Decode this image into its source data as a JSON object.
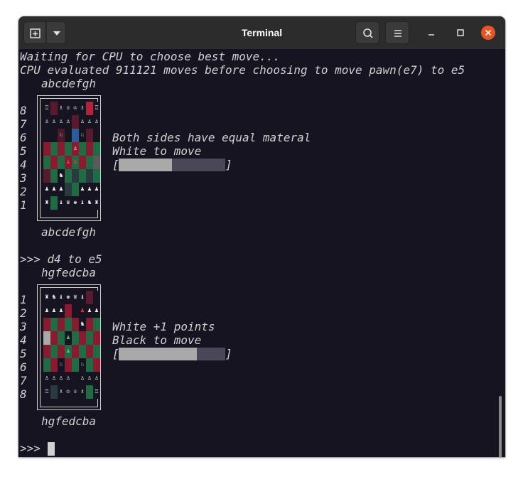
{
  "window": {
    "title": "Terminal",
    "icons": [
      "new-tab-icon",
      "chevron-down-icon",
      "search-icon",
      "hamburger-menu-icon",
      "minimize-icon",
      "maximize-icon",
      "close-icon"
    ],
    "colors": {
      "titlebar": "#2c2c2c",
      "terminal_bg": "#171421",
      "close": "#e95420",
      "text": "#d0d0d0"
    }
  },
  "terminal": {
    "line1": "Waiting for CPU to choose best move...",
    "line2": "CPU evaluated 911121 moves before choosing to move pawn(e7) to e5",
    "board1": {
      "files_top": "abcdefgh",
      "files_bottom": "abcdefgh",
      "ranks": [
        "8",
        "7",
        "6",
        "5",
        "4",
        "3",
        "2",
        "1"
      ],
      "info_line1": "Both sides have equal materal",
      "info_line2": "White to move",
      "bar_open": "[",
      "bar_close": "]",
      "bar_fraction": 0.5,
      "rows": [
        [
          "♖",
          "",
          "♗",
          "♕",
          "♔",
          "♗",
          "",
          "♖"
        ],
        [
          "♙",
          "♙",
          "♙",
          "♙",
          "",
          "♙",
          "♙",
          "♙"
        ],
        [
          "",
          "",
          "♘",
          "",
          "",
          "♘",
          "",
          ""
        ],
        [
          "",
          "",
          "",
          "",
          "♙",
          "",
          "",
          ""
        ],
        [
          "",
          "",
          "",
          "♟",
          "♟",
          "",
          "",
          ""
        ],
        [
          "",
          "",
          "♞",
          "",
          "",
          "",
          "",
          ""
        ],
        [
          "♟",
          "♟",
          "♟",
          "",
          "",
          "♟",
          "♟",
          "♟"
        ],
        [
          "♜",
          "",
          "♝",
          "♛",
          "♚",
          "♝",
          "♞",
          "♜"
        ]
      ],
      "colors": [
        [
          "#171421",
          "#5a1a2e",
          "#171421",
          "#171421",
          "#171421",
          "#171421",
          "#b8203a",
          "#171421"
        ],
        [
          "#171421",
          "#171421",
          "#171421",
          "#171421",
          "#5a1a2e",
          "#171421",
          "#171421",
          "#171421"
        ],
        [
          "#171421",
          "#171421",
          "#4a1a2a",
          "#171421",
          "#2a5aa0",
          "#171421",
          "#5a1a2e",
          "#171421"
        ],
        [
          "#8a1a30",
          "#1e6b44",
          "#8a1a30",
          "#1e6b44",
          "#8a1a30",
          "#1e6b44",
          "#8a1a30",
          "#1e6b44"
        ],
        [
          "#1e6b44",
          "#8a1a30",
          "#1e6b44",
          "#8a1a30",
          "#1e6b44",
          "#8a1a30",
          "#1e6b44",
          "#5a5a5a"
        ],
        [
          "#5a1a2e",
          "#1e6b44",
          "#171421",
          "#1e6b44",
          "#2a3a40",
          "#1e6b44",
          "#2a3a40",
          "#1e6b44"
        ],
        [
          "#171421",
          "#171421",
          "#171421",
          "#2a3a40",
          "#1e6b44",
          "#171421",
          "#171421",
          "#171421"
        ],
        [
          "#171421",
          "#1e6b44",
          "#171421",
          "#171421",
          "#171421",
          "#171421",
          "#171421",
          "#171421"
        ]
      ]
    },
    "command": ">>> d4 to e5",
    "board2": {
      "files_top": "hgfedcba",
      "files_bottom": "hgfedcba",
      "ranks": [
        "1",
        "2",
        "3",
        "4",
        "5",
        "6",
        "7",
        "8"
      ],
      "info_line1": "White +1 points",
      "info_line2": "Black to move",
      "bar_open": "[",
      "bar_close": "]",
      "bar_fraction": 0.73,
      "rows": [
        [
          "♜",
          "♞",
          "♝",
          "♚",
          "♛",
          "♝",
          "",
          ""
        ],
        [
          "♟",
          "♟",
          "♟",
          "",
          "",
          "♟",
          "♟",
          "♟"
        ],
        [
          "",
          "",
          "",
          "",
          "",
          "♞",
          "",
          ""
        ],
        [
          "",
          "",
          "",
          "♟",
          "",
          "",
          "",
          ""
        ],
        [
          "",
          "",
          "",
          "♟",
          "",
          "",
          "",
          ""
        ],
        [
          "",
          "",
          "♘",
          "",
          "",
          "♘",
          "",
          ""
        ],
        [
          "♙",
          "♙",
          "♙",
          "♙",
          "",
          "♙",
          "♙",
          "♙"
        ],
        [
          "♖",
          "",
          "♗",
          "♔",
          "♕",
          "♗",
          "",
          "♖"
        ]
      ],
      "colors": [
        [
          "#171421",
          "#171421",
          "#171421",
          "#171421",
          "#171421",
          "#171421",
          "#5a1a2e",
          "#171421"
        ],
        [
          "#171421",
          "#171421",
          "#171421",
          "#8a1a30",
          "#171421",
          "#171421",
          "#171421",
          "#171421"
        ],
        [
          "#8a1a30",
          "#1e6b44",
          "#8a1a30",
          "#1e6b44",
          "#8a1a30",
          "#171421",
          "#8a1a30",
          "#1e6b44"
        ],
        [
          "#a9a9a9",
          "#8a1a30",
          "#1e6b44",
          "#171421",
          "#1e6b44",
          "#8a1a30",
          "#1e6b44",
          "#8a1a30"
        ],
        [
          "#8a1a30",
          "#1e6b44",
          "#8a1a30",
          "#1e6b44",
          "#8a1a30",
          "#1e6b44",
          "#8a1a30",
          "#1e6b44"
        ],
        [
          "#1e6b44",
          "#8a1a30",
          "#171421",
          "#8a1a30",
          "#1e6b44",
          "#171421",
          "#1e6b44",
          "#8a1a30"
        ],
        [
          "#171421",
          "#171421",
          "#171421",
          "#171421",
          "#171421",
          "#171421",
          "#171421",
          "#171421"
        ],
        [
          "#171421",
          "#2a3a40",
          "#171421",
          "#171421",
          "#171421",
          "#171421",
          "#1e6b44",
          "#171421"
        ]
      ]
    },
    "prompt": ">>>"
  }
}
